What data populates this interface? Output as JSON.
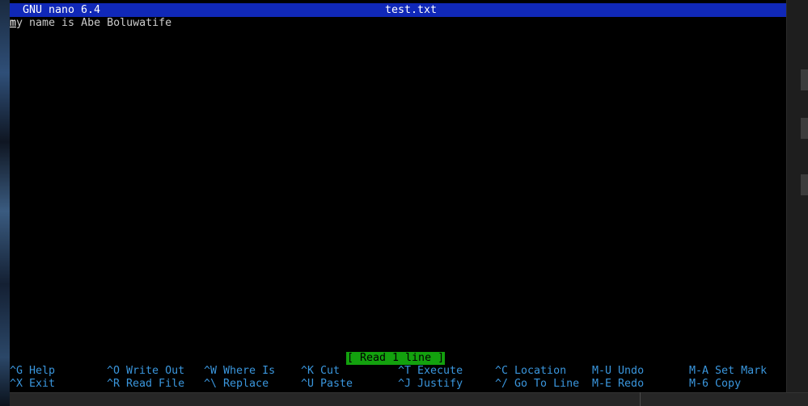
{
  "window": {
    "title_app": "GNU nano 6.4",
    "title_file": "test.txt"
  },
  "editor": {
    "first_char": "m",
    "rest_of_line": "y name is Abe Boluwatife"
  },
  "status": {
    "message": "[ Read 1 line ]"
  },
  "shortcuts_row1": [
    {
      "key": "^G",
      "label": "Help"
    },
    {
      "key": "^O",
      "label": "Write Out"
    },
    {
      "key": "^W",
      "label": "Where Is"
    },
    {
      "key": "^K",
      "label": "Cut"
    },
    {
      "key": "^T",
      "label": "Execute"
    },
    {
      "key": "^C",
      "label": "Location"
    },
    {
      "key": "M-U",
      "label": "Undo"
    },
    {
      "key": "M-A",
      "label": "Set Mark"
    }
  ],
  "shortcuts_row2": [
    {
      "key": "^X",
      "label": "Exit"
    },
    {
      "key": "^R",
      "label": "Read File"
    },
    {
      "key": "^\\",
      "label": "Replace"
    },
    {
      "key": "^U",
      "label": "Paste"
    },
    {
      "key": "^J",
      "label": "Justify"
    },
    {
      "key": "^/",
      "label": "Go To Line"
    },
    {
      "key": "M-E",
      "label": "Redo"
    },
    {
      "key": "M-6",
      "label": "Copy"
    }
  ],
  "colors": {
    "title_bar_bg": "#1028b8",
    "status_bg": "#13a10e",
    "shortcut_text": "#3a96dd"
  }
}
